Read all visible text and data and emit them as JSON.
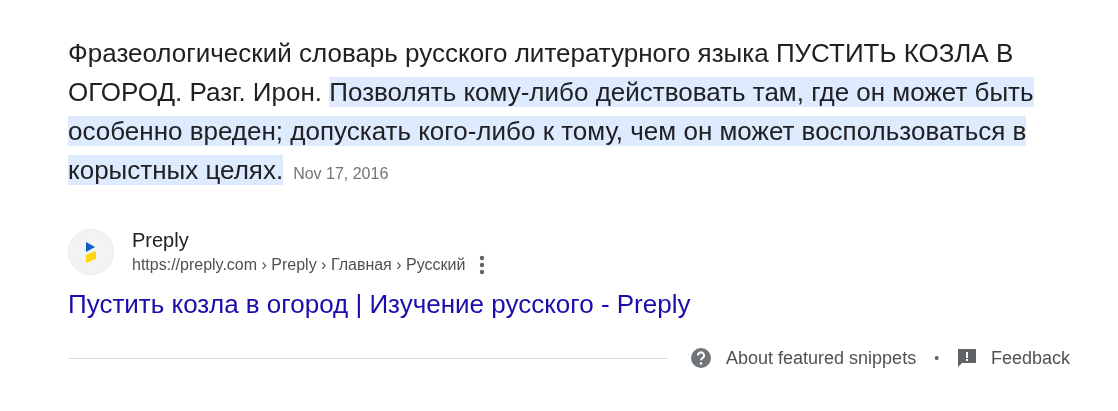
{
  "snippet": {
    "lead": "Фразеологический словарь русского литературного языка ПУСТИТЬ КОЗЛА В ОГОРОД. Разг. Ирон. ",
    "highlight": "Позволять кому-либо действовать там, где он может быть особенно вреден; допускать кого-либо к тому, чем он может воспользоваться в корыстных целях.",
    "date": "Nov 17, 2016"
  },
  "source": {
    "name": "Preply",
    "url": "https://preply.com › Preply › Главная › Русский"
  },
  "result_title": "Пустить козла в огород | Изучение русского - Preply",
  "footer": {
    "about": "About featured snippets",
    "separator": "•",
    "feedback": "Feedback"
  }
}
